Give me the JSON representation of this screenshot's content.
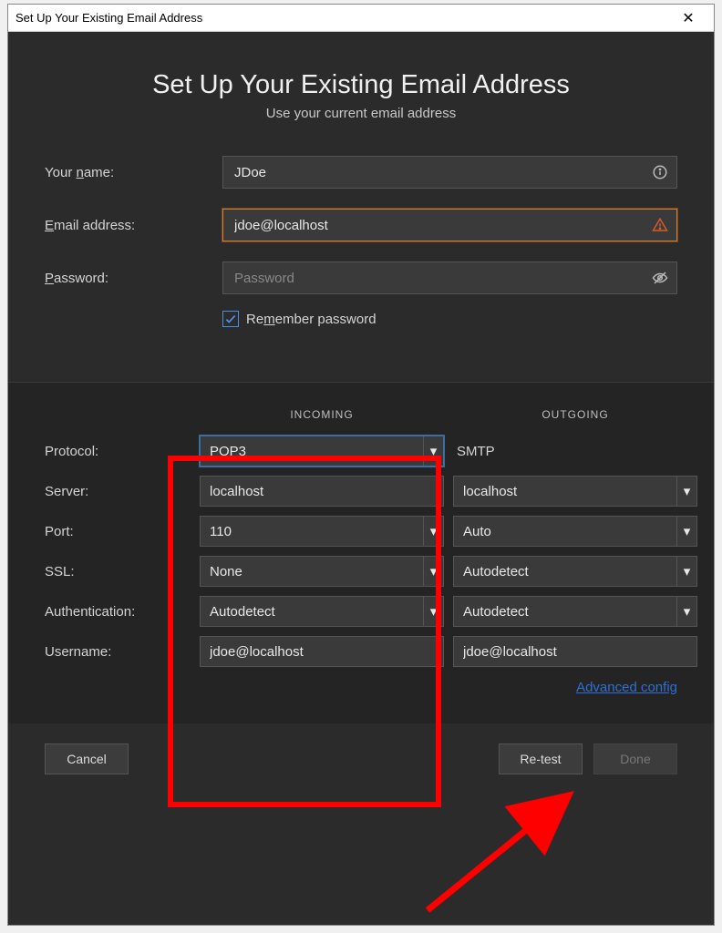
{
  "window": {
    "title": "Set Up Your Existing Email Address"
  },
  "intro": {
    "heading": "Set Up Your Existing Email Address",
    "sub": "Use your current email address"
  },
  "form": {
    "name_label_pre": "Your ",
    "name_label_u": "n",
    "name_label_post": "ame:",
    "name_value": "JDoe",
    "email_label_u": "E",
    "email_label_post": "mail address:",
    "email_value": "jdoe@localhost",
    "password_label_u": "P",
    "password_label_post": "assword:",
    "password_placeholder": "Password",
    "remember_pre": "Re",
    "remember_u": "m",
    "remember_post": "ember password"
  },
  "server": {
    "incoming_head": "INCOMING",
    "outgoing_head": "OUTGOING",
    "labels": {
      "protocol": "Protocol:",
      "server": "Server:",
      "port": "Port:",
      "ssl": "SSL:",
      "auth": "Authentication:",
      "user": "Username:"
    },
    "in": {
      "protocol": "POP3",
      "server": "localhost",
      "port": "110",
      "ssl": "None",
      "auth": "Autodetect",
      "user": "jdoe@localhost"
    },
    "out": {
      "protocol": "SMTP",
      "server": "localhost",
      "port": "Auto",
      "ssl": "Autodetect",
      "auth": "Autodetect",
      "user": "jdoe@localhost"
    }
  },
  "advanced": "Advanced config",
  "buttons": {
    "cancel_u": "C",
    "cancel_post": "ancel",
    "retest_pre": "Re-",
    "retest_u": "t",
    "retest_post": "est",
    "done_u": "D",
    "done_post": "one"
  }
}
